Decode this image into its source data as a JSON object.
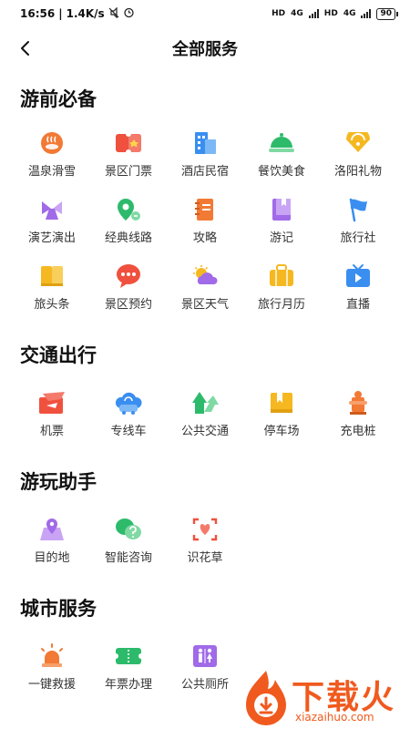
{
  "status_bar": {
    "time": "16:56",
    "speed": "1.4K/s",
    "hd1": "HD",
    "net1": "4G",
    "hd2": "HD",
    "net2": "4G",
    "battery": "90"
  },
  "header": {
    "title": "全部服务"
  },
  "sections": [
    {
      "title": "游前必备",
      "items": [
        {
          "label": "温泉滑雪",
          "icon": "hot-spring-icon"
        },
        {
          "label": "景区门票",
          "icon": "ticket-icon"
        },
        {
          "label": "酒店民宿",
          "icon": "hotel-icon"
        },
        {
          "label": "餐饮美食",
          "icon": "dining-cloche-icon"
        },
        {
          "label": "洛阳礼物",
          "icon": "gift-icon"
        },
        {
          "label": "演艺演出",
          "icon": "performance-icon"
        },
        {
          "label": "经典线路",
          "icon": "route-icon"
        },
        {
          "label": "攻略",
          "icon": "guide-notebook-icon"
        },
        {
          "label": "游记",
          "icon": "travel-notes-icon"
        },
        {
          "label": "旅行社",
          "icon": "flag-icon"
        },
        {
          "label": "旅头条",
          "icon": "news-icon"
        },
        {
          "label": "景区预约",
          "icon": "chat-bubble-icon"
        },
        {
          "label": "景区天气",
          "icon": "weather-icon"
        },
        {
          "label": "旅行月历",
          "icon": "suitcase-icon"
        },
        {
          "label": "直播",
          "icon": "live-tv-icon"
        }
      ]
    },
    {
      "title": "交通出行",
      "items": [
        {
          "label": "机票",
          "icon": "plane-ticket-icon"
        },
        {
          "label": "专线车",
          "icon": "cloud-bus-icon"
        },
        {
          "label": "公共交通",
          "icon": "transit-arrow-icon"
        },
        {
          "label": "停车场",
          "icon": "parking-book-icon"
        },
        {
          "label": "充电桩",
          "icon": "charging-pile-icon"
        }
      ]
    },
    {
      "title": "游玩助手",
      "items": [
        {
          "label": "目的地",
          "icon": "destination-icon"
        },
        {
          "label": "智能咨询",
          "icon": "consult-icon"
        },
        {
          "label": "识花草",
          "icon": "plant-scan-icon"
        }
      ]
    },
    {
      "title": "城市服务",
      "items": [
        {
          "label": "一键救援",
          "icon": "alarm-light-icon"
        },
        {
          "label": "年票办理",
          "icon": "annual-ticket-icon"
        },
        {
          "label": "公共厕所",
          "icon": "restroom-icon"
        }
      ]
    }
  ],
  "watermark": {
    "text": "下载火",
    "url": "xiazaihuo.com"
  },
  "colors": {
    "orange": "#f27a35",
    "red": "#f0513e",
    "blue": "#3a8ef0",
    "green": "#2dbb6b",
    "yellow": "#f5b820",
    "purple": "#a06ae8"
  }
}
